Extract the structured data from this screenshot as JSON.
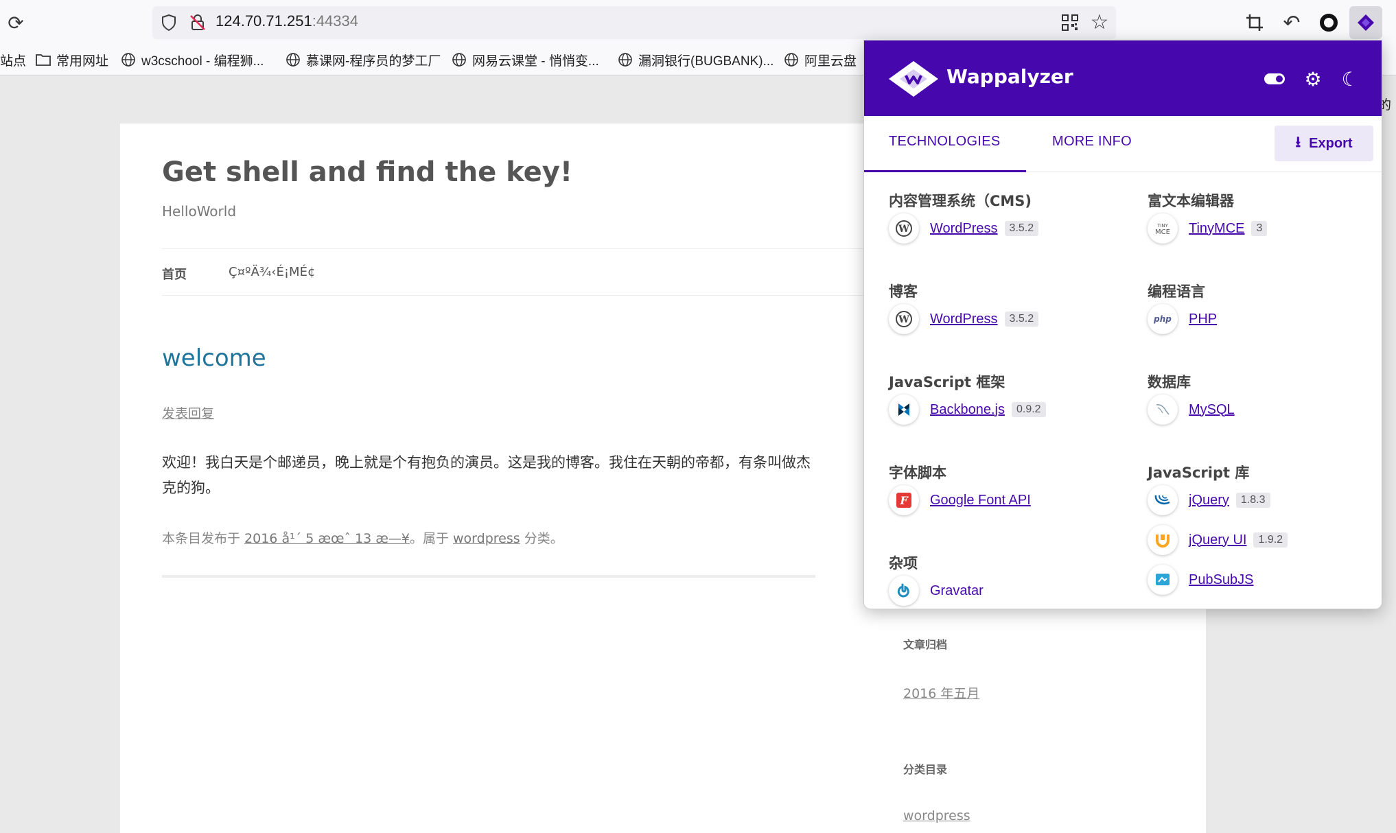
{
  "browser": {
    "url_host": "124.70.71.251",
    "url_port": ":44334",
    "icons": [
      "reload-icon",
      "shield-icon",
      "insecure-lock-icon",
      "qr-code-icon",
      "star-icon",
      "crop-icon",
      "undo-icon",
      "circle-extension-icon",
      "wappalyzer-extension-icon"
    ]
  },
  "bookmarks": [
    {
      "label": "站点"
    },
    {
      "label": "常用网址",
      "icon": "folder-icon"
    },
    {
      "label": "w3cschool - 编程狮...",
      "icon": "globe-icon"
    },
    {
      "label": "慕课网-程序员的梦工厂",
      "icon": "globe-icon"
    },
    {
      "label": "网易云课堂 - 悄悄变...",
      "icon": "globe-icon"
    },
    {
      "label": "漏洞银行(BUGBANK)...",
      "icon": "globe-icon"
    },
    {
      "label": "阿里云盘",
      "icon": "globe-icon"
    }
  ],
  "right_edge_text": "的",
  "page": {
    "site_title": "Get shell and find the key!",
    "site_description": "HelloWorld",
    "nav": {
      "home": "首页",
      "garbled": "Ç¤ºÄ¾‹É¡MÉ¢"
    },
    "post_title": "welcome",
    "reply_link": "发表回复",
    "post_body": "欢迎！我白天是个邮递员，晚上就是个有抱负的演员。这是我的博客。我住在天朝的帝都，有条叫做杰克的狗。",
    "meta": {
      "prefix": "本条目发布于 ",
      "date": "2016 å¹´ 5 æœˆ 13 æ—¥",
      "middle": "。属于 ",
      "category": "wordpress",
      "suffix": " 分类。"
    },
    "widgets": {
      "archive_title": "文章归档",
      "archive_link": "2016 年五月",
      "category_title": "分类目录",
      "category_link": "wordpress"
    }
  },
  "wappalyzer": {
    "brand": "Wappalyzer",
    "accent": "#4608ad",
    "tabs": {
      "technologies": "TECHNOLOGIES",
      "more_info": "MORE INFO"
    },
    "export": "Export",
    "categories": [
      {
        "title": "内容管理系统（CMS)",
        "items": [
          {
            "name": "WordPress",
            "version": "3.5.2",
            "icon": "wordpress-icon"
          }
        ]
      },
      {
        "title": "富文本编辑器",
        "items": [
          {
            "name": "TinyMCE",
            "version": "3",
            "icon": "tinymce-icon"
          }
        ]
      },
      {
        "title": "博客",
        "items": [
          {
            "name": "WordPress",
            "version": "3.5.2",
            "icon": "wordpress-icon"
          }
        ]
      },
      {
        "title": "编程语言",
        "items": [
          {
            "name": "PHP",
            "icon": "php-icon"
          }
        ]
      },
      {
        "title": "JavaScript 框架",
        "items": [
          {
            "name": "Backbone.js",
            "version": "0.9.2",
            "icon": "backbone-icon"
          }
        ]
      },
      {
        "title": "数据库",
        "items": [
          {
            "name": "MySQL",
            "icon": "mysql-icon"
          }
        ]
      },
      {
        "title": "字体脚本",
        "items": [
          {
            "name": "Google Font API",
            "icon": "google-font-icon"
          }
        ]
      },
      {
        "title": "JavaScript 库",
        "items": [
          {
            "name": "jQuery",
            "version": "1.8.3",
            "icon": "jquery-icon"
          },
          {
            "name": "jQuery UI",
            "version": "1.9.2",
            "icon": "jquery-ui-icon"
          },
          {
            "name": "PubSubJS",
            "icon": "pubsubjs-icon"
          }
        ]
      },
      {
        "title": "杂项",
        "items": [
          {
            "name": "Gravatar",
            "icon": "gravatar-icon"
          }
        ]
      }
    ]
  }
}
